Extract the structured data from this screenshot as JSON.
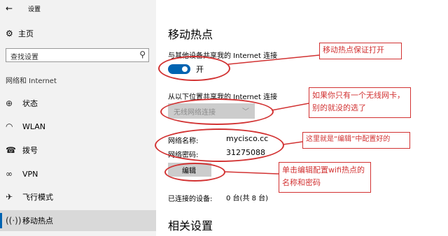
{
  "window": {
    "title": "设置"
  },
  "sidebar": {
    "home_label": "主页",
    "search_placeholder": "查找设置",
    "section_title": "网络和 Internet",
    "items": [
      {
        "label": "状态",
        "icon": "globe-icon"
      },
      {
        "label": "WLAN",
        "icon": "wifi-icon"
      },
      {
        "label": "拨号",
        "icon": "dialup-icon"
      },
      {
        "label": "VPN",
        "icon": "vpn-icon"
      },
      {
        "label": "飞行模式",
        "icon": "airplane-icon"
      },
      {
        "label": "移动热点",
        "icon": "hotspot-icon",
        "active": true
      }
    ]
  },
  "main": {
    "title": "移动热点",
    "share_label": "与其他设备共享我的 Internet 连接",
    "toggle_state": "开",
    "share_from_label": "从以下位置共享我的 Internet 连接",
    "share_from_value": "无线网络连接",
    "network_name_label": "网络名称:",
    "network_name": "mycisco.cc",
    "network_password_label": "网络密码:",
    "network_password": "31275088",
    "edit_button": "编辑",
    "connected_label": "已连接的设备:",
    "connected_value": "0 台(共 8 台)",
    "related_title": "相关设置"
  },
  "annotations": [
    {
      "text": "移动热点保证打开"
    },
    {
      "text": "如果你只有一个无线网卡，别的就没的选了"
    },
    {
      "text": "这里就是“编辑”中配置好的"
    },
    {
      "text": "单击编辑配置wifi热点的名称和密码"
    }
  ],
  "colors": {
    "accent": "#0063b1",
    "annotation": "#d23232"
  }
}
